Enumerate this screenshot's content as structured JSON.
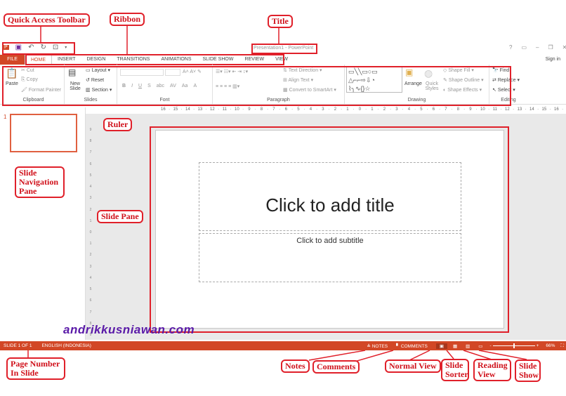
{
  "annotations": {
    "qat": "Quick Access Toolbar",
    "ribbon": "Ribbon",
    "title": "Title",
    "ruler": "Ruler",
    "slide_nav": "Slide Navigation Pane",
    "slide_pane": "Slide Pane",
    "page_number": "Page Number In Slide",
    "notes": "Notes",
    "comments": "Comments",
    "normal_view": "Normal View",
    "slide_sorter": "Slide Sorter",
    "reading_view": "Reading View",
    "slide_show": "Slide Show"
  },
  "window": {
    "title": "Presentation1 - PowerPoint",
    "help": "?",
    "sign_in": "Sign in"
  },
  "tabs": [
    "FILE",
    "HOME",
    "INSERT",
    "DESIGN",
    "TRANSITIONS",
    "ANIMATIONS",
    "SLIDE SHOW",
    "REVIEW",
    "VIEW"
  ],
  "ribbon": {
    "clipboard": {
      "label": "Clipboard",
      "paste": "Paste",
      "cut": "Cut",
      "copy": "Copy",
      "format_painter": "Format Painter"
    },
    "slides": {
      "label": "Slides",
      "new_slide": "New Slide",
      "layout": "Layout",
      "reset": "Reset",
      "section": "Section"
    },
    "font": {
      "label": "Font",
      "bold": "B",
      "italic": "I",
      "underline": "U",
      "shadow": "S",
      "strike": "abc",
      "spacing": "AV",
      "case": "Aa",
      "color": "A"
    },
    "paragraph": {
      "label": "Paragraph",
      "text_direction": "Text Direction",
      "align_text": "Align Text",
      "convert": "Convert to SmartArt"
    },
    "drawing": {
      "label": "Drawing",
      "arrange": "Arrange",
      "quick_styles": "Quick Styles",
      "shape_fill": "Shape Fill",
      "shape_outline": "Shape Outline",
      "shape_effects": "Shape Effects"
    },
    "editing": {
      "label": "Editing",
      "find": "Find",
      "replace": "Replace",
      "select": "Select"
    }
  },
  "ruler_labels": [
    "16",
    "15",
    "14",
    "13",
    "12",
    "11",
    "10",
    "9",
    "8",
    "7",
    "6",
    "5",
    "4",
    "3",
    "2",
    "1",
    "0",
    "1",
    "2",
    "3",
    "4",
    "5",
    "6",
    "7",
    "8",
    "9",
    "10",
    "11",
    "12",
    "13",
    "14",
    "15",
    "16"
  ],
  "vruler_labels": [
    "9",
    "8",
    "7",
    "6",
    "5",
    "4",
    "3",
    "2",
    "1",
    "0",
    "1",
    "2",
    "3",
    "4",
    "5",
    "6",
    "7",
    "8",
    "9"
  ],
  "slide_nav": {
    "number": "1"
  },
  "slide": {
    "title_placeholder": "Click to add title",
    "subtitle_placeholder": "Click to add subtitle"
  },
  "status": {
    "slide": "SLIDE 1 OF 1",
    "language": "ENGLISH (INDONESIA)",
    "notes": "NOTES",
    "comments": "COMMENTS",
    "zoom": "66%",
    "zoom_level_percent": 66
  },
  "watermark": "andrikkusniawan.com",
  "colors": {
    "accent": "#D24726",
    "annotation": "#E0202A",
    "watermark": "#5A1AA8"
  }
}
